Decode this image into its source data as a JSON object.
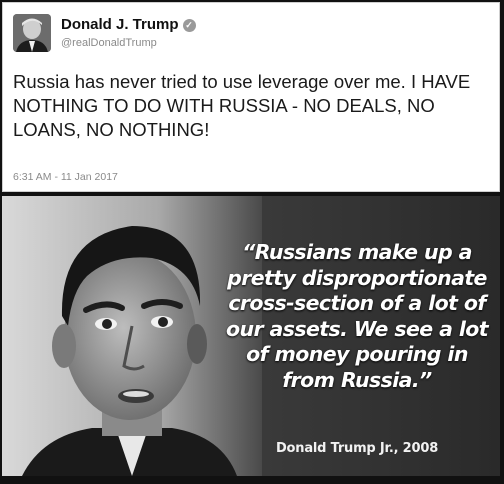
{
  "tweet": {
    "author_name": "Donald J. Trump",
    "verified_icon": "verified-badge-icon",
    "handle": "@realDonaldTrump",
    "text": "Russia has never tried to use leverage over me. I HAVE NOTHING TO DO WITH RUSSIA - NO DEALS, NO LOANS, NO NOTHING!",
    "timestamp": "6:31 AM - 11 Jan 2017",
    "avatar": "profile-photo"
  },
  "quote_panel": {
    "photo": "portrait-photo",
    "quote": "“Russians make up a\npretty disproportionate\ncross-section of a lot of\nour assets. We see a lot\nof money pouring in\nfrom Russia.”",
    "attribution": "Donald Trump Jr., 2008"
  }
}
